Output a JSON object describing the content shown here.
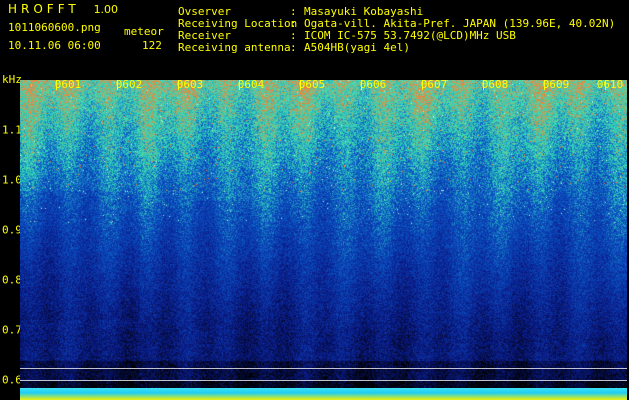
{
  "header": {
    "brand": "HROFFT",
    "version": "1.00",
    "filename": "1011060600.png",
    "datetime": "10.11.06 06:00",
    "mode": "meteor",
    "count": "122",
    "meta": [
      {
        "key": "Ovserver",
        "value": "Masayuki Kobayashi"
      },
      {
        "key": "Receiving Location",
        "value": "Ogata-vill. Akita-Pref. JAPAN (139.96E, 40.02N)"
      },
      {
        "key": "Receiver",
        "value": "ICOM IC-575 53.7492(@LCD)MHz USB"
      },
      {
        "key": "Receiving antenna",
        "value": "A504HB(yagi 4el)"
      }
    ],
    "separator": ":"
  },
  "axis": {
    "unit": "kHz",
    "y_ticks": [
      "1.1",
      "1.0",
      "0.9",
      "0.8",
      "0.7",
      "0.6"
    ],
    "x_ticks": [
      "0601",
      "0602",
      "0603",
      "0604",
      "0605",
      "0606",
      "0607",
      "0608",
      "0609",
      "0610"
    ]
  },
  "palette": {
    "background": "#000000",
    "label": "#ffff00",
    "low": "#0a1a8a",
    "mid": "#0b54c8",
    "high": "#35e2b8",
    "peak": "#ff7a2a"
  }
}
